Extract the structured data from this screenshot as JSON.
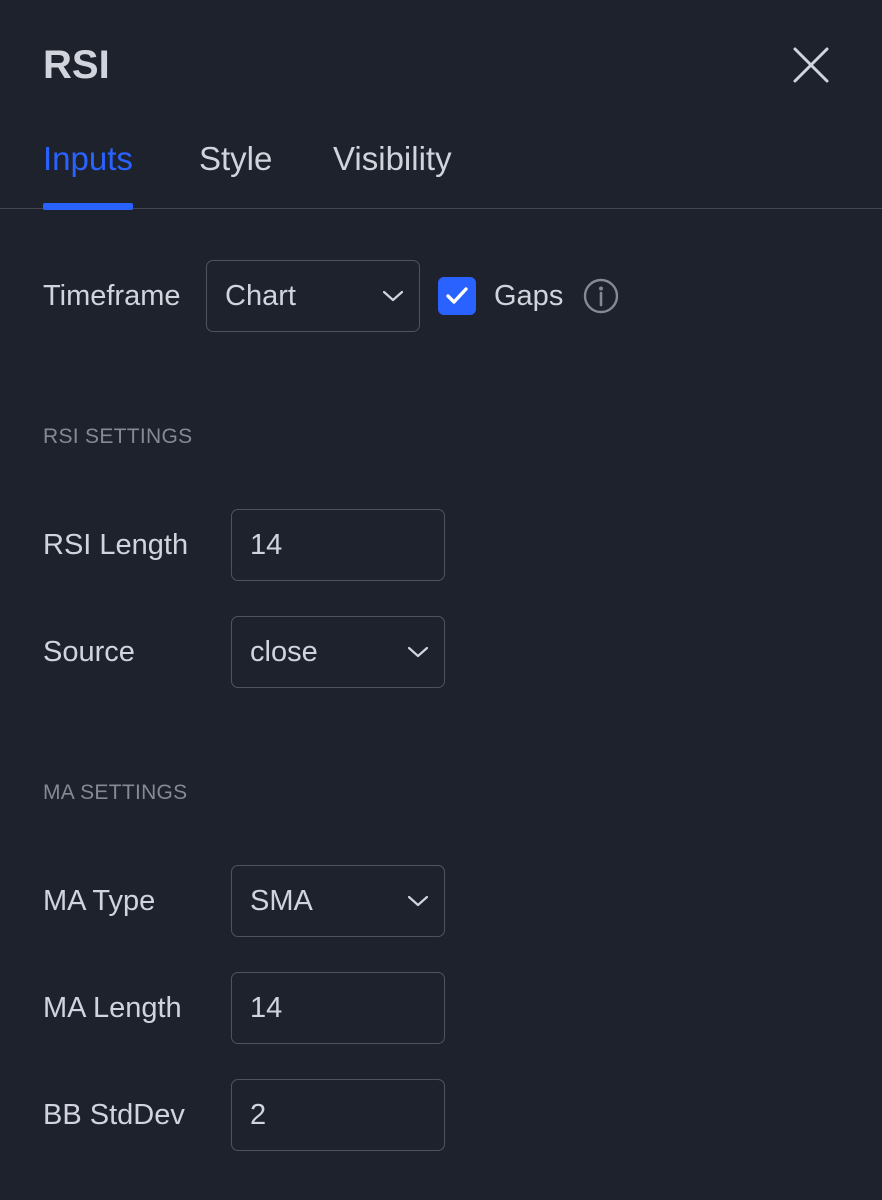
{
  "header": {
    "title": "RSI"
  },
  "tabs": [
    {
      "label": "Inputs",
      "active": true
    },
    {
      "label": "Style",
      "active": false
    },
    {
      "label": "Visibility",
      "active": false
    }
  ],
  "timeframe": {
    "label": "Timeframe",
    "value": "Chart",
    "gaps_label": "Gaps",
    "gaps_checked": true
  },
  "rsi_settings": {
    "heading": "RSI SETTINGS",
    "length_label": "RSI Length",
    "length_value": "14",
    "source_label": "Source",
    "source_value": "close"
  },
  "ma_settings": {
    "heading": "MA SETTINGS",
    "type_label": "MA Type",
    "type_value": "SMA",
    "length_label": "MA Length",
    "length_value": "14",
    "bb_label": "BB StdDev",
    "bb_value": "2"
  },
  "colors": {
    "background": "#1e222d",
    "accent": "#2962ff",
    "text": "#d1d4dc",
    "muted": "#868993",
    "border": "#50535e"
  },
  "icons": {
    "close": "close-icon",
    "dropdown": "chevron-down-icon",
    "check": "check-icon",
    "info": "info-icon"
  }
}
